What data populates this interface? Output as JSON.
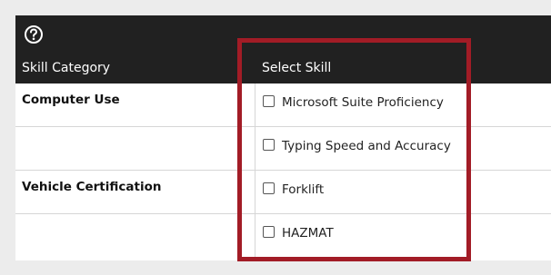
{
  "header": {
    "help_icon": "question-circle-icon",
    "columns": {
      "category": "Skill Category",
      "skill": "Select Skill"
    }
  },
  "rows": [
    {
      "category": "Computer Use",
      "skill": "Microsoft Suite Proficiency",
      "checked": false
    },
    {
      "category": "",
      "skill": "Typing Speed and Accuracy",
      "checked": false
    },
    {
      "category": "Vehicle Certification",
      "skill": "Forklift",
      "checked": false
    },
    {
      "category": "",
      "skill": "HAZMAT",
      "checked": false
    }
  ],
  "colors": {
    "header_bg": "#212121",
    "highlight": "#a21c26",
    "page_bg": "#ececec"
  }
}
